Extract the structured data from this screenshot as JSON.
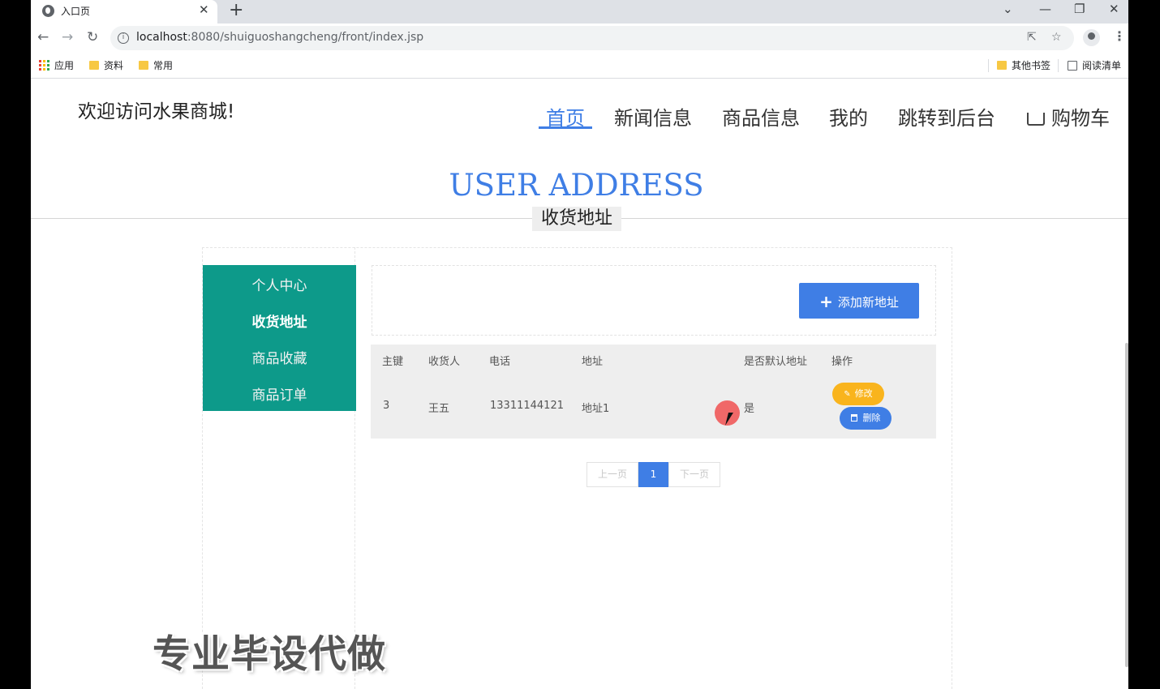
{
  "browser": {
    "tab_title": "入口页",
    "url_host": "localhost",
    "url_rest": ":8080/shuiguoshangcheng/front/index.jsp",
    "bookmarks": {
      "apps": "应用",
      "folder1": "资料",
      "folder2": "常用",
      "other": "其他书签",
      "reading_list": "阅读清单"
    }
  },
  "header": {
    "welcome": "欢迎访问水果商城!",
    "nav": [
      "首页",
      "新闻信息",
      "商品信息",
      "我的",
      "跳转到后台",
      "购物车"
    ],
    "active_nav": "首页"
  },
  "hero": {
    "title": "USER ADDRESS",
    "subtitle": "收货地址"
  },
  "sidebar": {
    "items": [
      "个人中心",
      "收货地址",
      "商品收藏",
      "商品订单"
    ],
    "active": "收货地址",
    "color": "#0d9a8a"
  },
  "toolbar": {
    "add_label": "添加新地址"
  },
  "table": {
    "headers": [
      "主键",
      "收货人",
      "电话",
      "地址",
      "是否默认地址",
      "操作"
    ],
    "rows": [
      {
        "id": "3",
        "name": "王五",
        "phone": "13311144121",
        "address": "地址1",
        "default": "是"
      }
    ],
    "edit_label": "修改",
    "delete_label": "删除"
  },
  "pagination": {
    "prev": "上一页",
    "current": "1",
    "next": "下一页"
  },
  "watermark": "专业毕设代做",
  "colors": {
    "accent": "#3f7ee5",
    "warning": "#f9b41d",
    "teal": "#0d9a8a"
  }
}
